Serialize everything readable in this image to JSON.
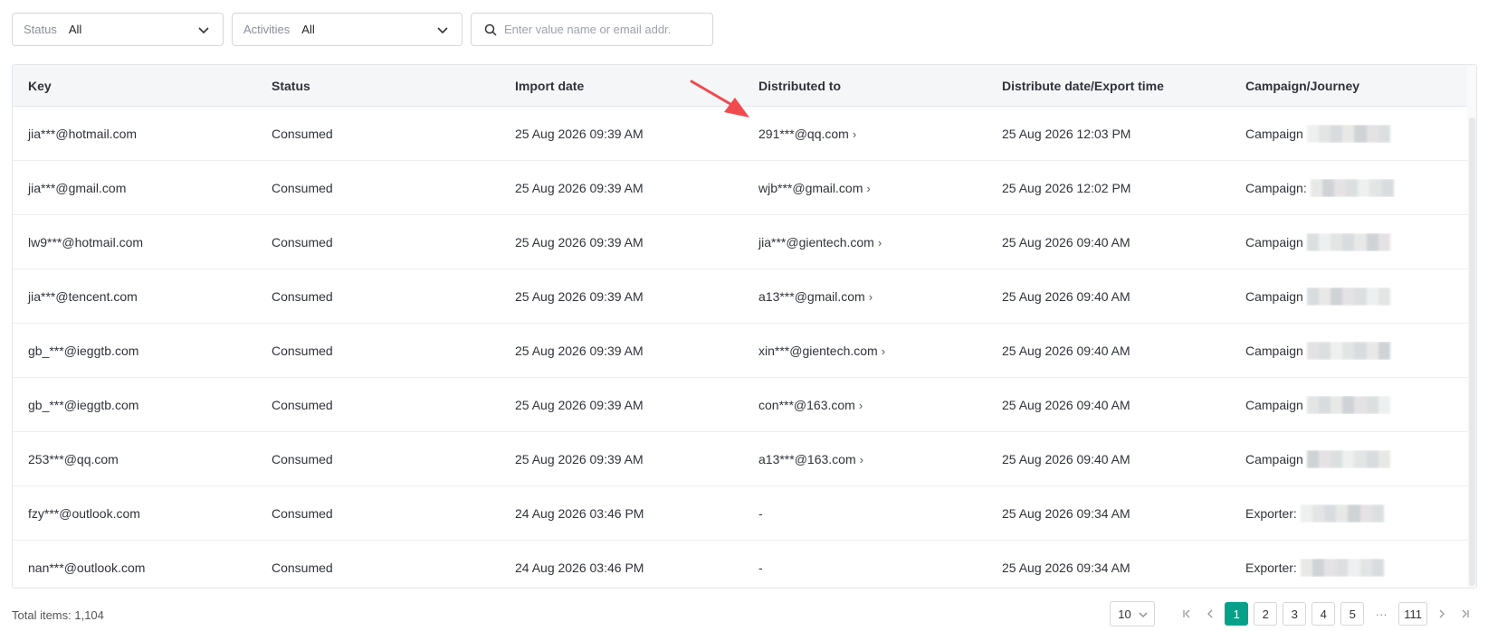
{
  "filters": {
    "status": {
      "label": "Status",
      "value": "All"
    },
    "activities": {
      "label": "Activities",
      "value": "All"
    },
    "search": {
      "placeholder": "Enter value name or email addr."
    }
  },
  "table": {
    "columns": [
      "Key",
      "Status",
      "Import date",
      "Distributed to",
      "Distribute date/Export time",
      "Campaign/Journey"
    ],
    "rows": [
      {
        "key": "jia***@hotmail.com",
        "status": "Consumed",
        "import_date": "25 Aug 2026 09:39 AM",
        "distributed_to": "291***@qq.com",
        "dist_arrow": "›",
        "distribute_date": "25 Aug 2026 12:03 PM",
        "campaign": "Campaign"
      },
      {
        "key": "jia***@gmail.com",
        "status": "Consumed",
        "import_date": "25 Aug 2026 09:39 AM",
        "distributed_to": "wjb***@gmail.com",
        "dist_arrow": "›",
        "distribute_date": "25 Aug 2026 12:02 PM",
        "campaign": "Campaign:"
      },
      {
        "key": "lw9***@hotmail.com",
        "status": "Consumed",
        "import_date": "25 Aug 2026 09:39 AM",
        "distributed_to": "jia***@gientech.com",
        "dist_arrow": "›",
        "distribute_date": "25 Aug 2026 09:40 AM",
        "campaign": "Campaign"
      },
      {
        "key": "jia***@tencent.com",
        "status": "Consumed",
        "import_date": "25 Aug 2026 09:39 AM",
        "distributed_to": "a13***@gmail.com",
        "dist_arrow": "›",
        "distribute_date": "25 Aug 2026 09:40 AM",
        "campaign": "Campaign"
      },
      {
        "key": "gb_***@ieggtb.com",
        "status": "Consumed",
        "import_date": "25 Aug 2026 09:39 AM",
        "distributed_to": "xin***@gientech.com",
        "dist_arrow": "›",
        "distribute_date": "25 Aug 2026 09:40 AM",
        "campaign": "Campaign"
      },
      {
        "key": "gb_***@ieggtb.com",
        "status": "Consumed",
        "import_date": "25 Aug 2026 09:39 AM",
        "distributed_to": "con***@163.com",
        "dist_arrow": "›",
        "distribute_date": "25 Aug 2026 09:40 AM",
        "campaign": "Campaign"
      },
      {
        "key": "253***@qq.com",
        "status": "Consumed",
        "import_date": "25 Aug 2026 09:39 AM",
        "distributed_to": "a13***@163.com",
        "dist_arrow": "›",
        "distribute_date": "25 Aug 2026 09:40 AM",
        "campaign": "Campaign"
      },
      {
        "key": "fzy***@outlook.com",
        "status": "Consumed",
        "import_date": "24 Aug 2026 03:46 PM",
        "distributed_to": "-",
        "dist_arrow": "",
        "distribute_date": "25 Aug 2026 09:34 AM",
        "campaign": "Exporter:"
      },
      {
        "key": "nan***@outlook.com",
        "status": "Consumed",
        "import_date": "24 Aug 2026 03:46 PM",
        "distributed_to": "-",
        "dist_arrow": "",
        "distribute_date": "25 Aug 2026 09:34 AM",
        "campaign": "Exporter:"
      }
    ]
  },
  "footer": {
    "total_label": "Total items: 1,104",
    "page_size": "10",
    "pages": [
      "1",
      "2",
      "3",
      "4",
      "5"
    ],
    "current_page": "1",
    "ellipsis": "···",
    "last_page": "111"
  },
  "colors": {
    "accent": "#07a18a",
    "annotation_arrow": "#f04a4f"
  }
}
